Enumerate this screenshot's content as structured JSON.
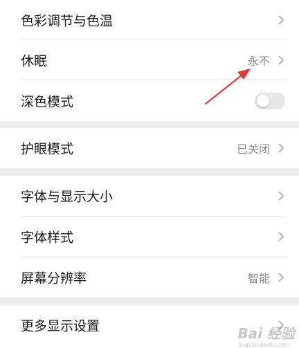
{
  "settings": {
    "group1": [
      {
        "label": "色彩调节与色温",
        "value": ""
      },
      {
        "label": "休眠",
        "value": "永不"
      },
      {
        "label": "深色模式",
        "toggle": false
      }
    ],
    "group2": [
      {
        "label": "护眼模式",
        "value": "已关闭"
      }
    ],
    "group3": [
      {
        "label": "字体与显示大小",
        "value": ""
      },
      {
        "label": "字体样式",
        "value": ""
      },
      {
        "label": "屏幕分辨率",
        "value": "智能"
      }
    ],
    "group4": [
      {
        "label": "更多显示设置",
        "value": ""
      }
    ]
  },
  "annotation": {
    "arrow_color": "#e53935"
  },
  "watermark": {
    "text": "Bai 经验",
    "sub": "jingyan.baidu.com"
  },
  "icons": {
    "chevron": "chevron-right-icon",
    "arrow": "red-arrow-annotation"
  }
}
